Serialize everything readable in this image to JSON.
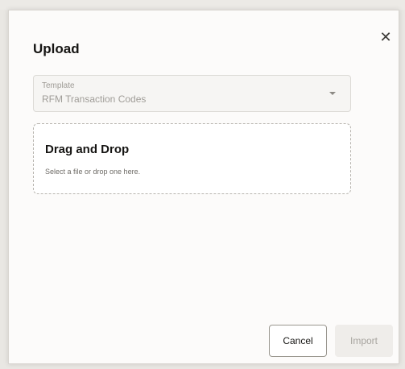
{
  "dialog": {
    "title": "Upload",
    "close_icon": "close-icon"
  },
  "template_select": {
    "label": "Template",
    "value": "RFM Transaction Codes",
    "caret_icon": "chevron-down-icon"
  },
  "dropzone": {
    "title": "Drag and Drop",
    "subtitle": "Select a file or drop one here."
  },
  "footer": {
    "cancel_label": "Cancel",
    "import_label": "Import"
  }
}
